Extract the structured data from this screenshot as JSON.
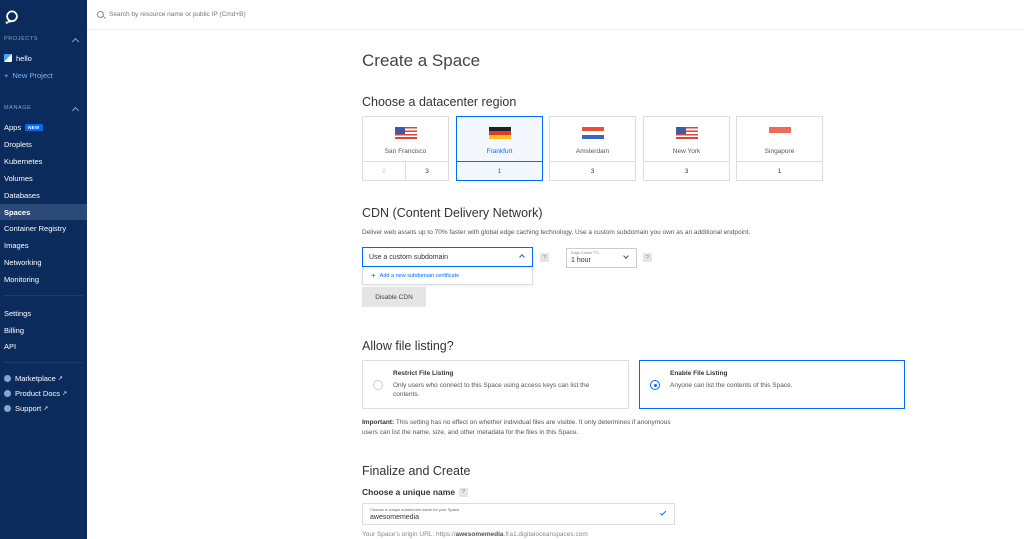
{
  "sidebar": {
    "projects_heading": "PROJECTS",
    "projects": [
      {
        "label": "hello"
      }
    ],
    "new_project": "New Project",
    "manage_heading": "MANAGE",
    "manage_items": [
      {
        "label": "Apps",
        "badge": "NEW"
      },
      {
        "label": "Droplets"
      },
      {
        "label": "Kubernetes"
      },
      {
        "label": "Volumes"
      },
      {
        "label": "Databases"
      },
      {
        "label": "Spaces",
        "active": true
      },
      {
        "label": "Container Registry"
      },
      {
        "label": "Images"
      },
      {
        "label": "Networking"
      },
      {
        "label": "Monitoring"
      }
    ],
    "account_items": [
      {
        "label": "Settings"
      },
      {
        "label": "Billing"
      },
      {
        "label": "API"
      }
    ],
    "external_items": [
      {
        "label": "Marketplace",
        "ext": "↗"
      },
      {
        "label": "Product Docs",
        "ext": "↗"
      },
      {
        "label": "Support",
        "ext": "↗"
      }
    ]
  },
  "search": {
    "placeholder": "Search by resource name or public IP (Cmd+B)"
  },
  "page": {
    "title": "Create a Space"
  },
  "datacenter": {
    "heading": "Choose a datacenter region",
    "regions": [
      {
        "name": "San Francisco",
        "flag": "us",
        "counts": [
          "2",
          "3"
        ],
        "selected": false
      },
      {
        "name": "Frankfurt",
        "flag": "de",
        "counts": [
          "1"
        ],
        "selected": true
      },
      {
        "name": "Amsterdam",
        "flag": "nl",
        "counts": [
          "3"
        ],
        "selected": false
      },
      {
        "name": "New York",
        "flag": "us",
        "counts": [
          "3"
        ],
        "selected": false
      },
      {
        "name": "Singapore",
        "flag": "sg",
        "counts": [
          "1"
        ],
        "selected": false
      }
    ]
  },
  "cdn": {
    "heading": "CDN (Content Delivery Network)",
    "description": "Deliver web assets up to 70% faster with global edge caching technology. Use a custom subdomain you own as an additional endpoint.",
    "subdomain_select": "Use a custom subdomain",
    "add_certificate": "Add a new subdomain certificate",
    "ttl_label": "Edge Cache TTL",
    "ttl_value": "1 hour",
    "help": "?",
    "disable_button": "Disable CDN"
  },
  "file_listing": {
    "heading": "Allow file listing?",
    "options": [
      {
        "title": "Restrict File Listing",
        "description": "Only users who connect to this Space using access keys can list the contents.",
        "selected": false
      },
      {
        "title": "Enable File Listing",
        "description": "Anyone can list the contents of this Space.",
        "selected": true
      }
    ],
    "note_bold": "Important:",
    "note_text": " This setting has no effect on whether individual files are visible. It only determines if anonymous users can list the name, size, and other metadata for the files in this Space."
  },
  "finalize": {
    "heading": "Finalize and Create",
    "name_heading": "Choose a unique name",
    "help": "?",
    "name_label": "Choose a unique subdomain name for your Space",
    "name_value": "awesomemedia",
    "origin_prefix": "Your Space's origin URL: https://",
    "origin_name": "awesomemedia",
    "origin_suffix": ".fra1.digitaloceanspaces.com"
  },
  "colors": {
    "sidebar_bg": "#0a2b5c",
    "accent": "#0069ff"
  }
}
